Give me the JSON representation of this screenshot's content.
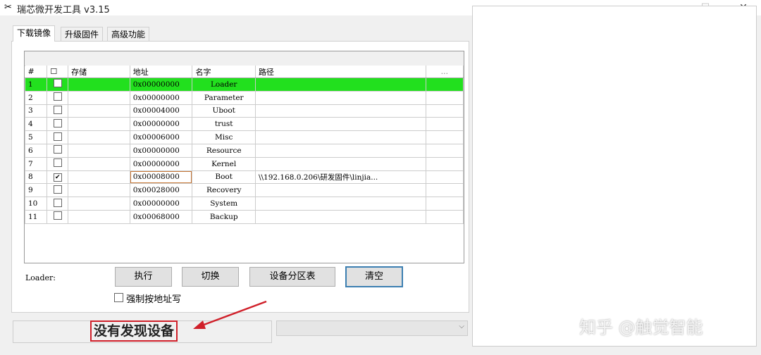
{
  "window": {
    "title": "瑞芯微开发工具 v3.15",
    "minimize": "—",
    "maximize": "☐",
    "close": "✕"
  },
  "tabs": [
    {
      "label": "下载镜像"
    },
    {
      "label": "升级固件"
    },
    {
      "label": "高级功能"
    }
  ],
  "table": {
    "headers": [
      "#",
      "☐",
      "存储",
      "地址",
      "名字",
      "路径",
      "..."
    ],
    "rows": [
      {
        "n": "1",
        "checked": false,
        "addr": "0x00000000",
        "name": "Loader",
        "path": ""
      },
      {
        "n": "2",
        "checked": false,
        "addr": "0x00000000",
        "name": "Parameter",
        "path": ""
      },
      {
        "n": "3",
        "checked": false,
        "addr": "0x00004000",
        "name": "Uboot",
        "path": ""
      },
      {
        "n": "4",
        "checked": false,
        "addr": "0x00000000",
        "name": "trust",
        "path": ""
      },
      {
        "n": "5",
        "checked": false,
        "addr": "0x00006000",
        "name": "Misc",
        "path": ""
      },
      {
        "n": "6",
        "checked": false,
        "addr": "0x00000000",
        "name": "Resource",
        "path": ""
      },
      {
        "n": "7",
        "checked": false,
        "addr": "0x00000000",
        "name": "Kernel",
        "path": ""
      },
      {
        "n": "8",
        "checked": true,
        "addr": "0x00008000",
        "name": "Boot",
        "path": "\\\\192.168.0.206\\研发固件\\linjia..."
      },
      {
        "n": "9",
        "checked": false,
        "addr": "0x00028000",
        "name": "Recovery",
        "path": ""
      },
      {
        "n": "10",
        "checked": false,
        "addr": "0x00000000",
        "name": "System",
        "path": ""
      },
      {
        "n": "11",
        "checked": false,
        "addr": "0x00068000",
        "name": "Backup",
        "path": ""
      }
    ],
    "selected_row": "1",
    "highlight_color": "#22e01e"
  },
  "loader_label": "Loader:",
  "buttons": {
    "run": "执行",
    "switch": "切换",
    "partition": "设备分区表",
    "clear": "清空"
  },
  "force_addr": {
    "label": "强制按地址写",
    "checked": false
  },
  "status": "没有发现设备",
  "watermark": "知乎 @触觉智能"
}
